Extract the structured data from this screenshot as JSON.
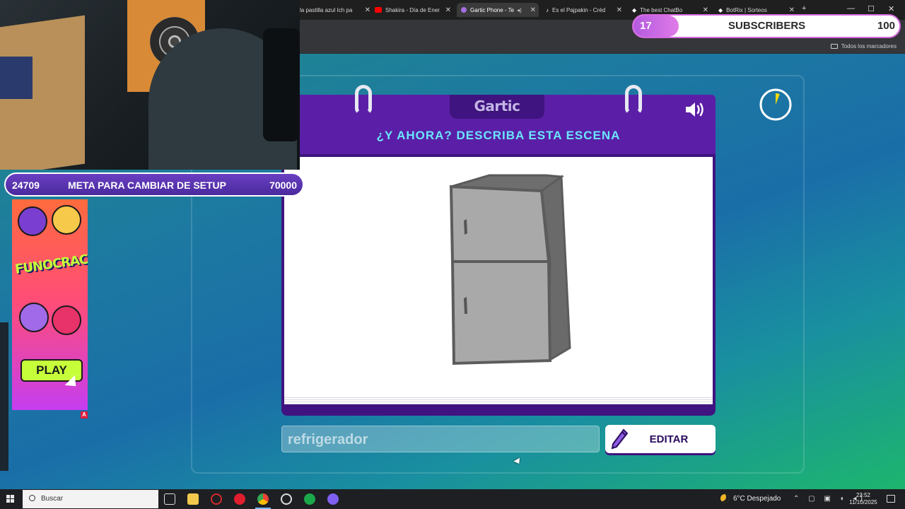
{
  "browser": {
    "tabs": [
      {
        "label": "la pastilla azul Ich pa",
        "icon_color": "#888888"
      },
      {
        "label": "Shakira - Día de Ener",
        "icon_color": "#ff0000"
      },
      {
        "label": "Gartic Phone - Te",
        "icon_color": "#a46de0",
        "active": true
      },
      {
        "label": "Es el Pajpakin - Créd",
        "icon_color": "#ffffff"
      },
      {
        "label": "The best ChatBo",
        "icon_color": "#ffffff"
      },
      {
        "label": "BotRix | Sorteos",
        "icon_color": "#ffffff"
      }
    ],
    "new_tab": "+",
    "bookmarks_all": "Todos los marcadores"
  },
  "stream": {
    "goal": {
      "current": "24709",
      "label": "META PARA CAMBIAR DE SETUP",
      "target": "70000"
    },
    "subs": {
      "current": "17",
      "label": "SUBSCRIBERS",
      "target": "100",
      "progress": 0.17
    },
    "ad": {
      "logo": "FUNOCRACY",
      "play": "PLAY",
      "badge": "A"
    }
  },
  "game": {
    "logo": "Gartic",
    "prompt": "¿Y AHORA? DESCRIBA ESTA ESCENA",
    "answer": "refrigerador",
    "edit_label": "EDITAR",
    "sound_icon": "speaker-icon",
    "timer_remaining": 0.94
  },
  "taskbar": {
    "search_placeholder": "Buscar",
    "weather": "6°C  Despejado",
    "time": "23:52",
    "date": "11/10/2025"
  },
  "colors": {
    "gartic_purple": "#5a1fa6",
    "prompt_cyan": "#6be6ff",
    "timer_yellow": "#f5d90a"
  }
}
